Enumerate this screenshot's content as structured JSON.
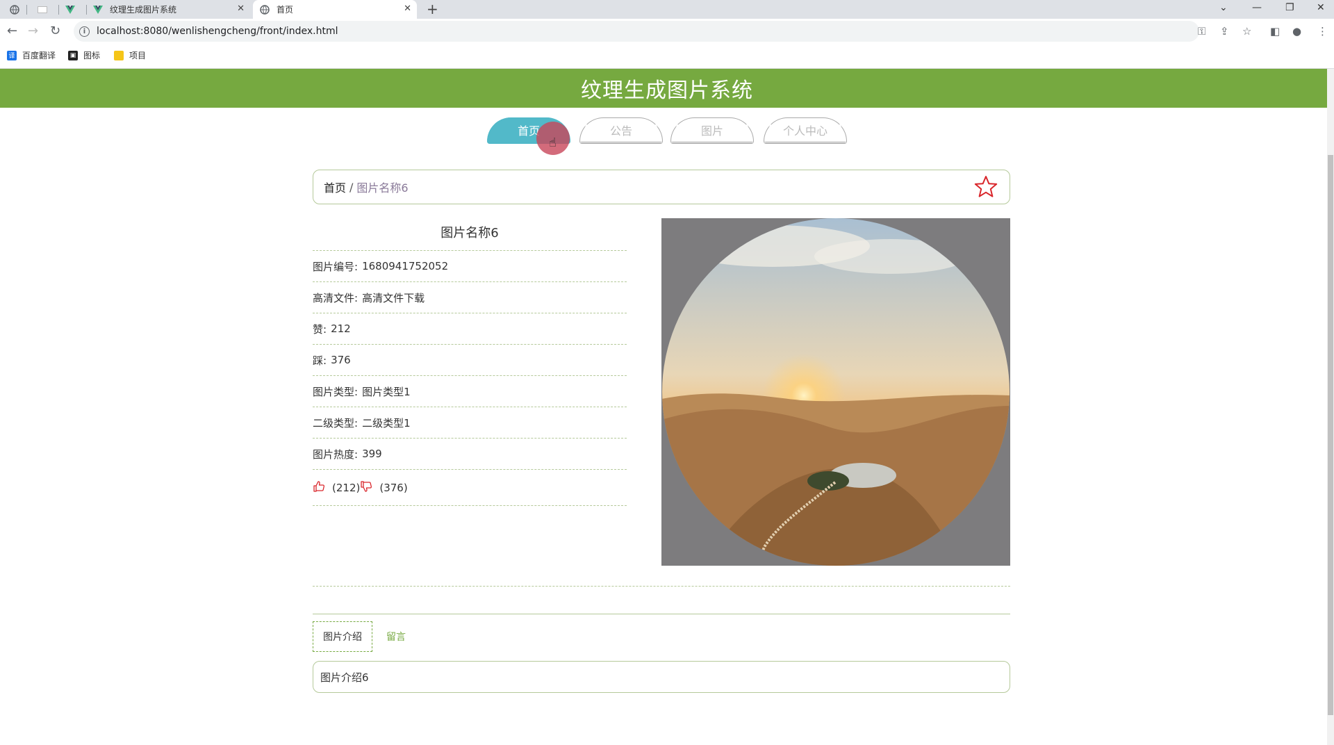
{
  "browser": {
    "tabs": [
      {
        "title": ""
      },
      {
        "title": ""
      },
      {
        "title": ""
      },
      {
        "title": "纹理生成图片系统"
      },
      {
        "title": "首页"
      }
    ],
    "url": "localhost:8080/wenlishengcheng/front/index.html",
    "bookmarks": [
      {
        "label": "百度翻译",
        "icon": "translate-icon",
        "color": "#1a73e8"
      },
      {
        "label": "图标",
        "icon": "icon-bookmark",
        "color": "#222222"
      },
      {
        "label": "项目",
        "icon": "folder-icon",
        "color": "#f5c518"
      }
    ]
  },
  "site": {
    "title": "纹理生成图片系统",
    "header_color": "#76a940"
  },
  "menu": [
    {
      "label": "首页",
      "active": true
    },
    {
      "label": "公告",
      "active": false
    },
    {
      "label": "图片",
      "active": false
    },
    {
      "label": "个人中心",
      "active": false
    }
  ],
  "breadcrumb": {
    "home": "首页",
    "separator": "/",
    "current": "图片名称6"
  },
  "detail": {
    "title": "图片名称6",
    "fields": [
      {
        "label": "图片编号:",
        "value": "1680941752052"
      },
      {
        "label": "高清文件:",
        "value": "高清文件下载"
      },
      {
        "label": "赞:",
        "value": "212"
      },
      {
        "label": "踩:",
        "value": "376"
      },
      {
        "label": "图片类型:",
        "value": "图片类型1"
      },
      {
        "label": "二级类型:",
        "value": "二级类型1"
      },
      {
        "label": "图片热度:",
        "value": "399"
      }
    ],
    "likes": "(212)",
    "dislikes": "(376)",
    "photo_caption": "https://tp.pconline.com.cn/9199266"
  },
  "tabs": [
    {
      "label": "图片介绍",
      "active": true
    },
    {
      "label": "留言",
      "active": false
    }
  ],
  "tab_content": "图片介绍6",
  "colors": {
    "accent": "#76a940",
    "menu_active": "#52b9c9",
    "star": "#d9262b"
  }
}
